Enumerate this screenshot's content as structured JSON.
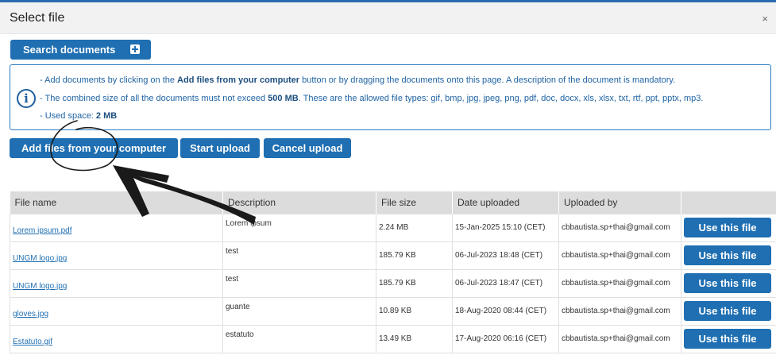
{
  "dialog": {
    "title": "Select file",
    "close_glyph": "×"
  },
  "search": {
    "label": "Search documents",
    "icon": "plus-square-icon"
  },
  "info": {
    "icon": "info-icon",
    "line1_pre": "- Add documents by clicking on the ",
    "line1_bold": "Add files from your computer",
    "line1_post": " button or by dragging the documents onto this page. A description of the document is mandatory.",
    "line2_pre": "- The combined size of all the documents must not exceed ",
    "line2_bold": "500 MB",
    "line2_post": ". These are the allowed file types: gif, bmp, jpg, jpeg, png, pdf, doc, docx, xls, xlsx, txt, rtf, ppt, pptx, mp3.",
    "line3_pre": "- Used space: ",
    "line3_bold": "2 MB"
  },
  "actions": {
    "add": "Add files from your computer",
    "start": "Start upload",
    "cancel": "Cancel upload"
  },
  "table": {
    "headers": [
      "File name",
      "Description",
      "File size",
      "Date uploaded",
      "Uploaded by",
      ""
    ],
    "use_label": "Use this file",
    "rows": [
      {
        "name": "Lorem ipsum.pdf",
        "desc": "Lorem ipsum",
        "size": "2.24 MB",
        "date": "15-Jan-2025 15:10 (CET)",
        "by": "cbbautista.sp+thai@gmail.com"
      },
      {
        "name": "UNGM logo.jpg",
        "desc": "test",
        "size": "185.79 KB",
        "date": "06-Jul-2023 18:48 (CET)",
        "by": "cbbautista.sp+thai@gmail.com"
      },
      {
        "name": "UNGM logo.jpg",
        "desc": "test",
        "size": "185.79 KB",
        "date": "06-Jul-2023 18:47 (CET)",
        "by": "cbbautista.sp+thai@gmail.com"
      },
      {
        "name": "gloves.jpg",
        "desc": "guante",
        "size": "10.89 KB",
        "date": "18-Aug-2020 08:44 (CET)",
        "by": "cbbautista.sp+thai@gmail.com"
      },
      {
        "name": "Estatuto.gif",
        "desc": "estatuto",
        "size": "13.49 KB",
        "date": "17-Aug-2020 06:16 (CET)",
        "by": "cbbautista.sp+thai@gmail.com"
      }
    ]
  },
  "colors": {
    "primary": "#1f6fb2",
    "info_text": "#2064a4",
    "header_bg": "#f2f2f2",
    "table_head_bg": "#dcdcdc"
  }
}
